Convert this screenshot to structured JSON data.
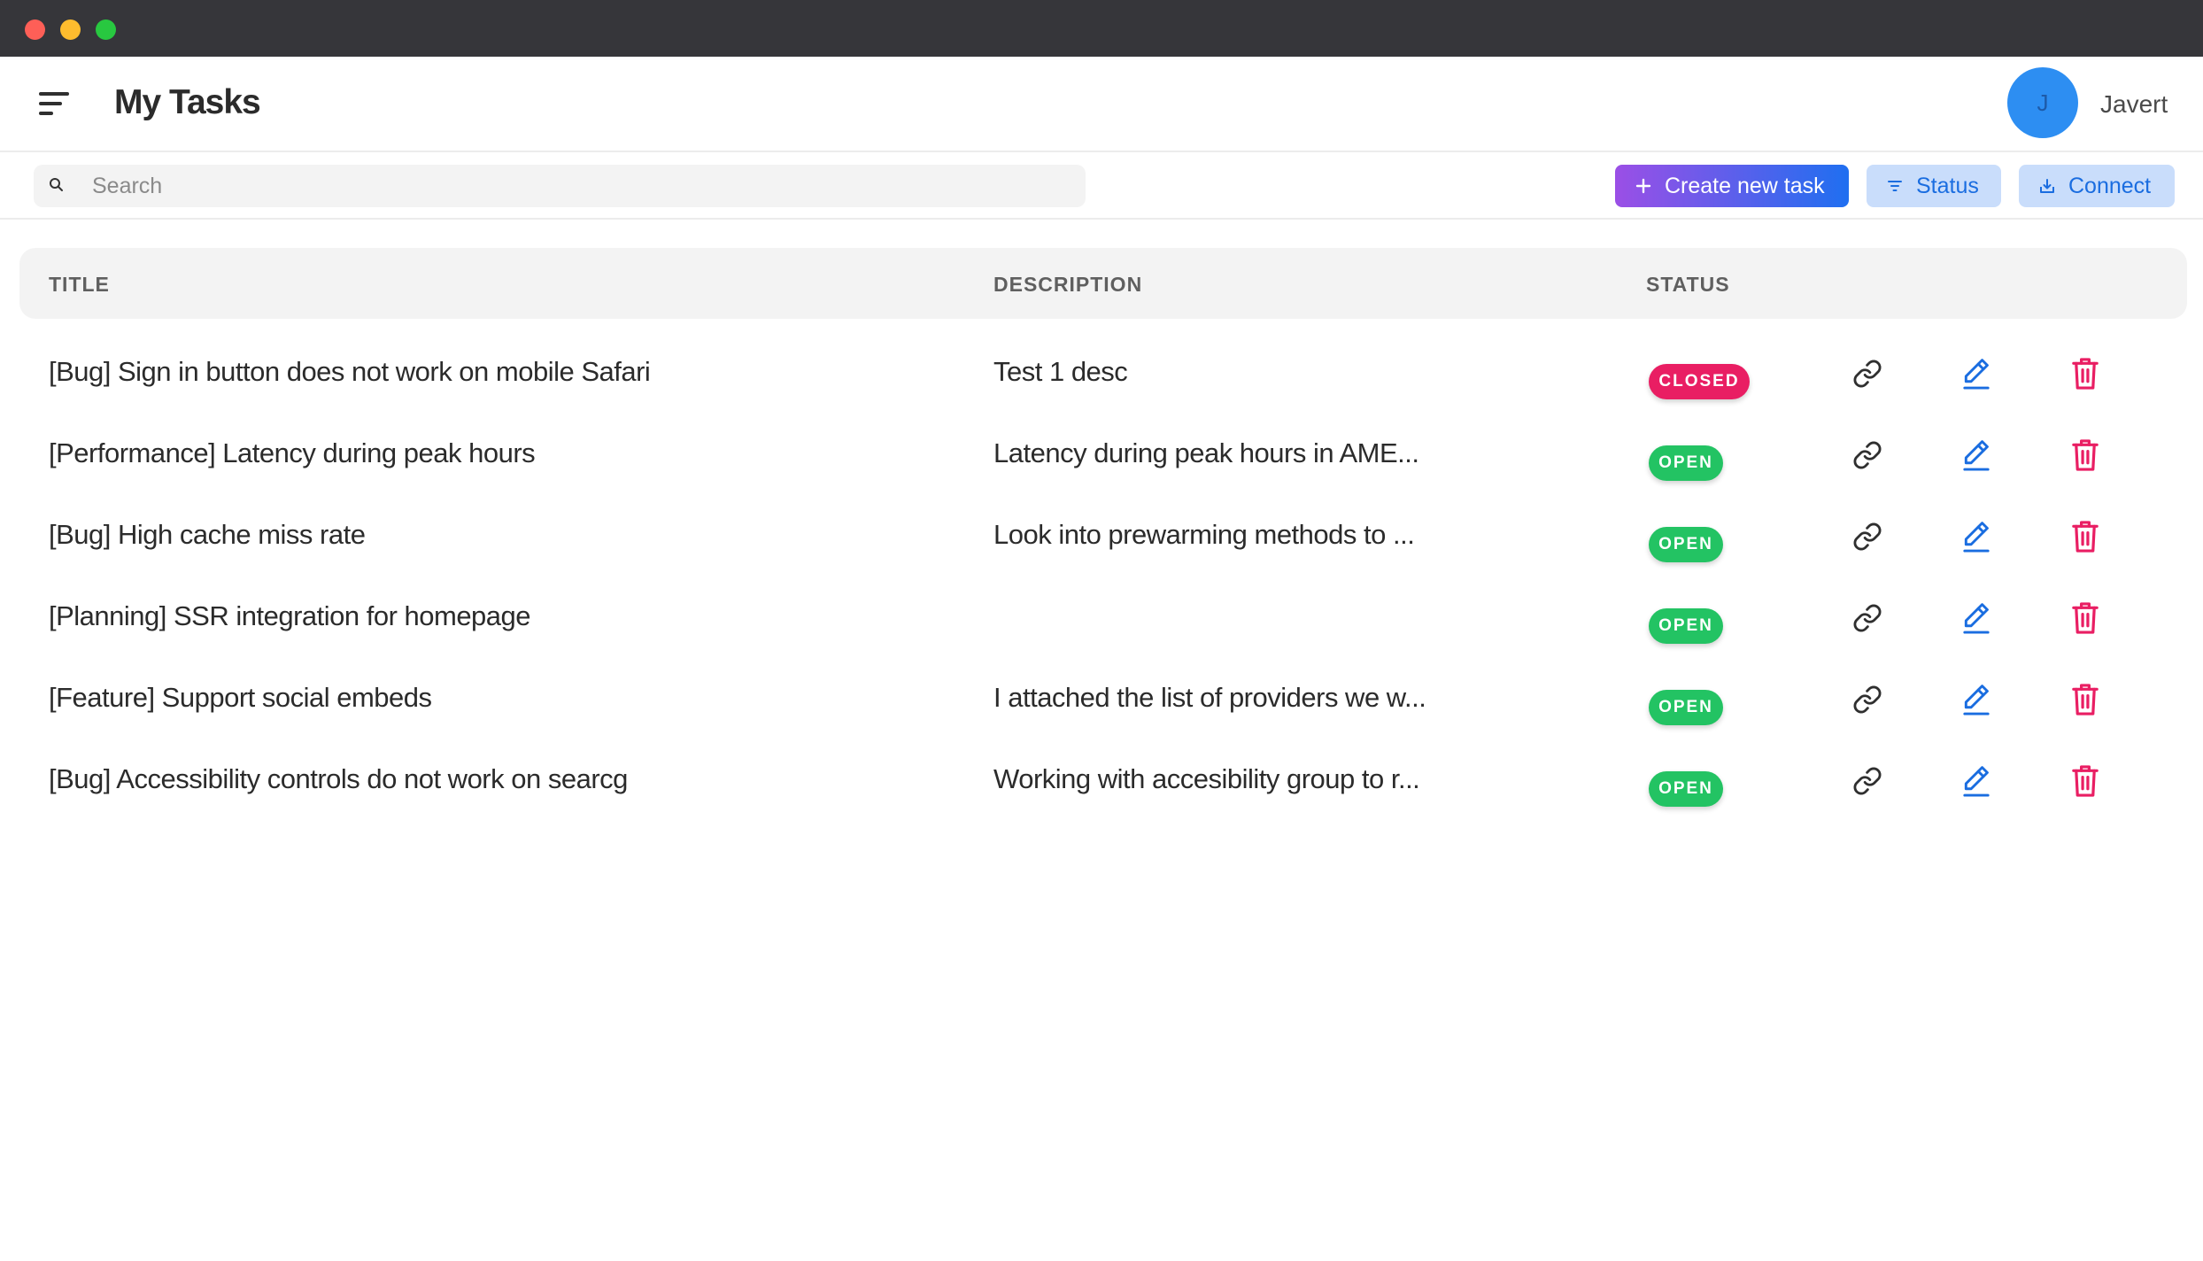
{
  "window": {
    "traffic_lights": [
      "close",
      "minimize",
      "maximize"
    ]
  },
  "header": {
    "title": "My Tasks",
    "menu_icon": "hamburger-menu-icon",
    "user": {
      "initial": "J",
      "name": "Javert",
      "avatar_color": "#2d8ef2"
    }
  },
  "toolbar": {
    "search_placeholder": "Search",
    "search_value": "",
    "create_label": "Create new task",
    "status_label": "Status",
    "connect_label": "Connect"
  },
  "table": {
    "headers": {
      "title": "TITLE",
      "description": "DESCRIPTION",
      "status": "STATUS"
    },
    "rows": [
      {
        "title": "[Bug] Sign in button does not work on mobile Safari",
        "description": "Test 1 desc",
        "status": "CLOSED"
      },
      {
        "title": "[Performance] Latency during peak hours",
        "description": "Latency during peak hours in AME...",
        "status": "OPEN"
      },
      {
        "title": "[Bug] High cache miss rate",
        "description": "Look into prewarming methods to ...",
        "status": "OPEN"
      },
      {
        "title": "[Planning] SSR integration for homepage",
        "description": "",
        "status": "OPEN"
      },
      {
        "title": "[Feature] Support social embeds",
        "description": "I attached the list of providers we w...",
        "status": "OPEN"
      },
      {
        "title": "[Bug] Accessibility controls do not work on searcg",
        "description": "Working with accesibility group to r...",
        "status": "OPEN"
      }
    ],
    "row_actions": [
      "link-icon",
      "edit-icon",
      "trash-icon"
    ]
  },
  "colors": {
    "closed": "#e91e63",
    "open": "#23c363",
    "accent_blue": "#1a6de0",
    "delete_red": "#e91e63"
  }
}
